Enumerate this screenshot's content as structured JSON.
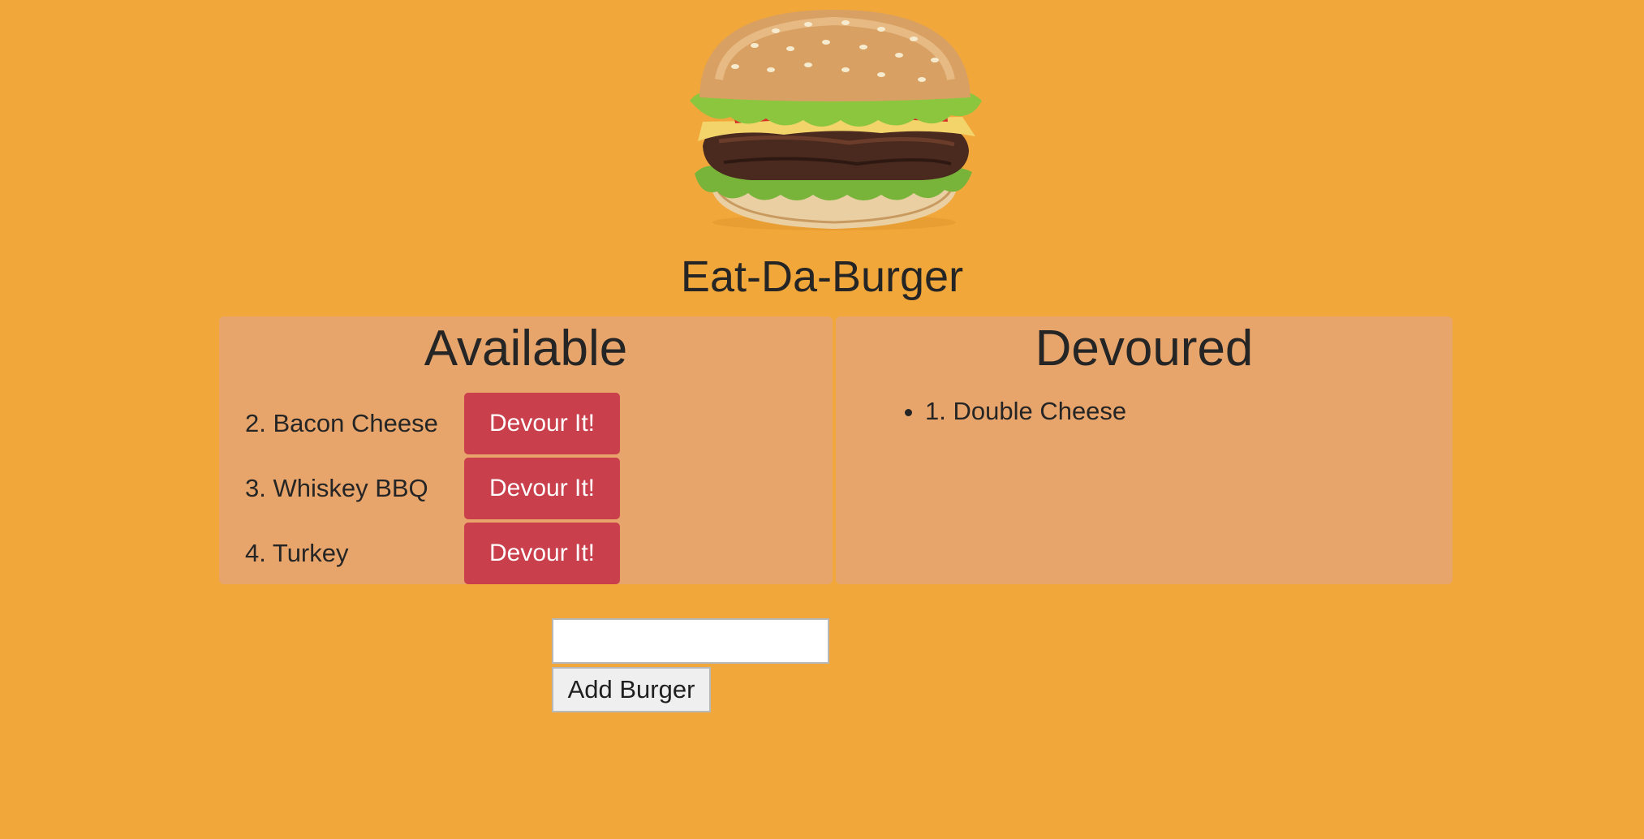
{
  "header": {
    "logo_icon": "hamburger-image",
    "title": "Eat-Da-Burger"
  },
  "available": {
    "heading": "Available",
    "items": [
      {
        "label": "2. Bacon Cheese",
        "button_label": "Devour It!"
      },
      {
        "label": "3. Whiskey BBQ",
        "button_label": "Devour It!"
      },
      {
        "label": "4. Turkey",
        "button_label": "Devour It!"
      }
    ]
  },
  "devoured": {
    "heading": "Devoured",
    "items": [
      {
        "label": "1. Double Cheese"
      }
    ]
  },
  "form": {
    "input_value": "",
    "input_placeholder": "",
    "submit_label": "Add Burger"
  },
  "colors": {
    "background": "#F2A73B",
    "panel": "#E7A56C",
    "devour_button": "#C9404C"
  }
}
